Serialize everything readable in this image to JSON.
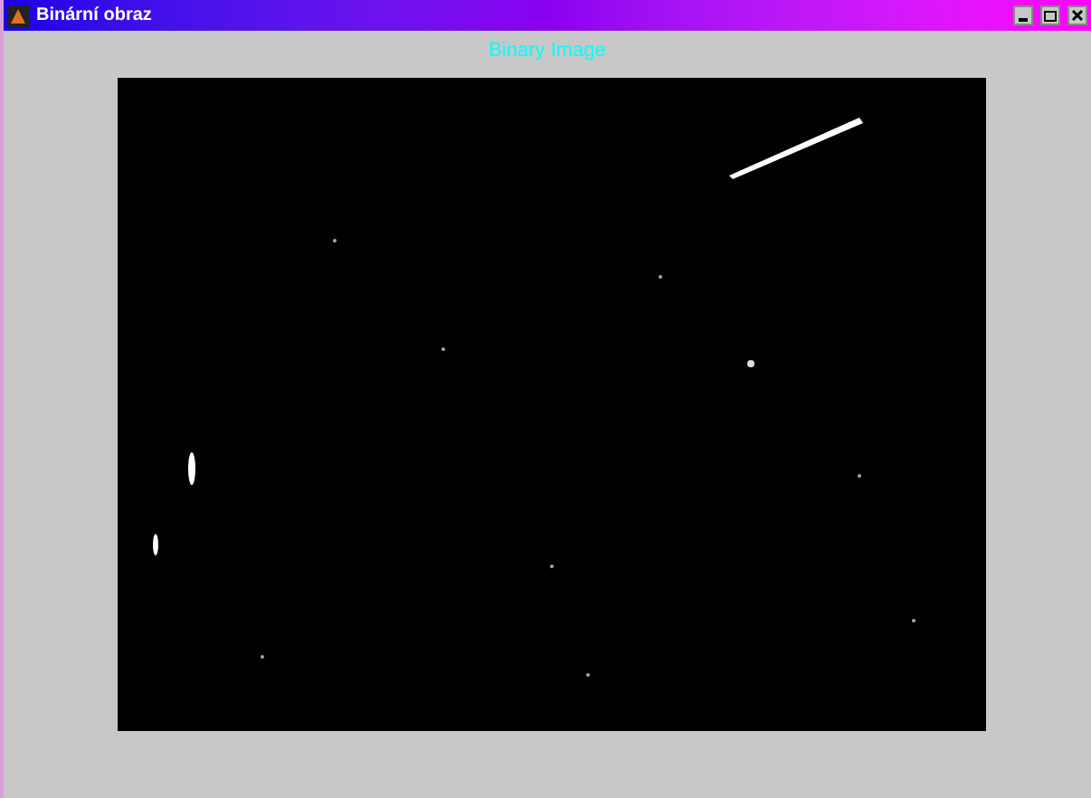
{
  "window": {
    "title": "Binární obraz"
  },
  "figure": {
    "title": "Binary Image"
  }
}
